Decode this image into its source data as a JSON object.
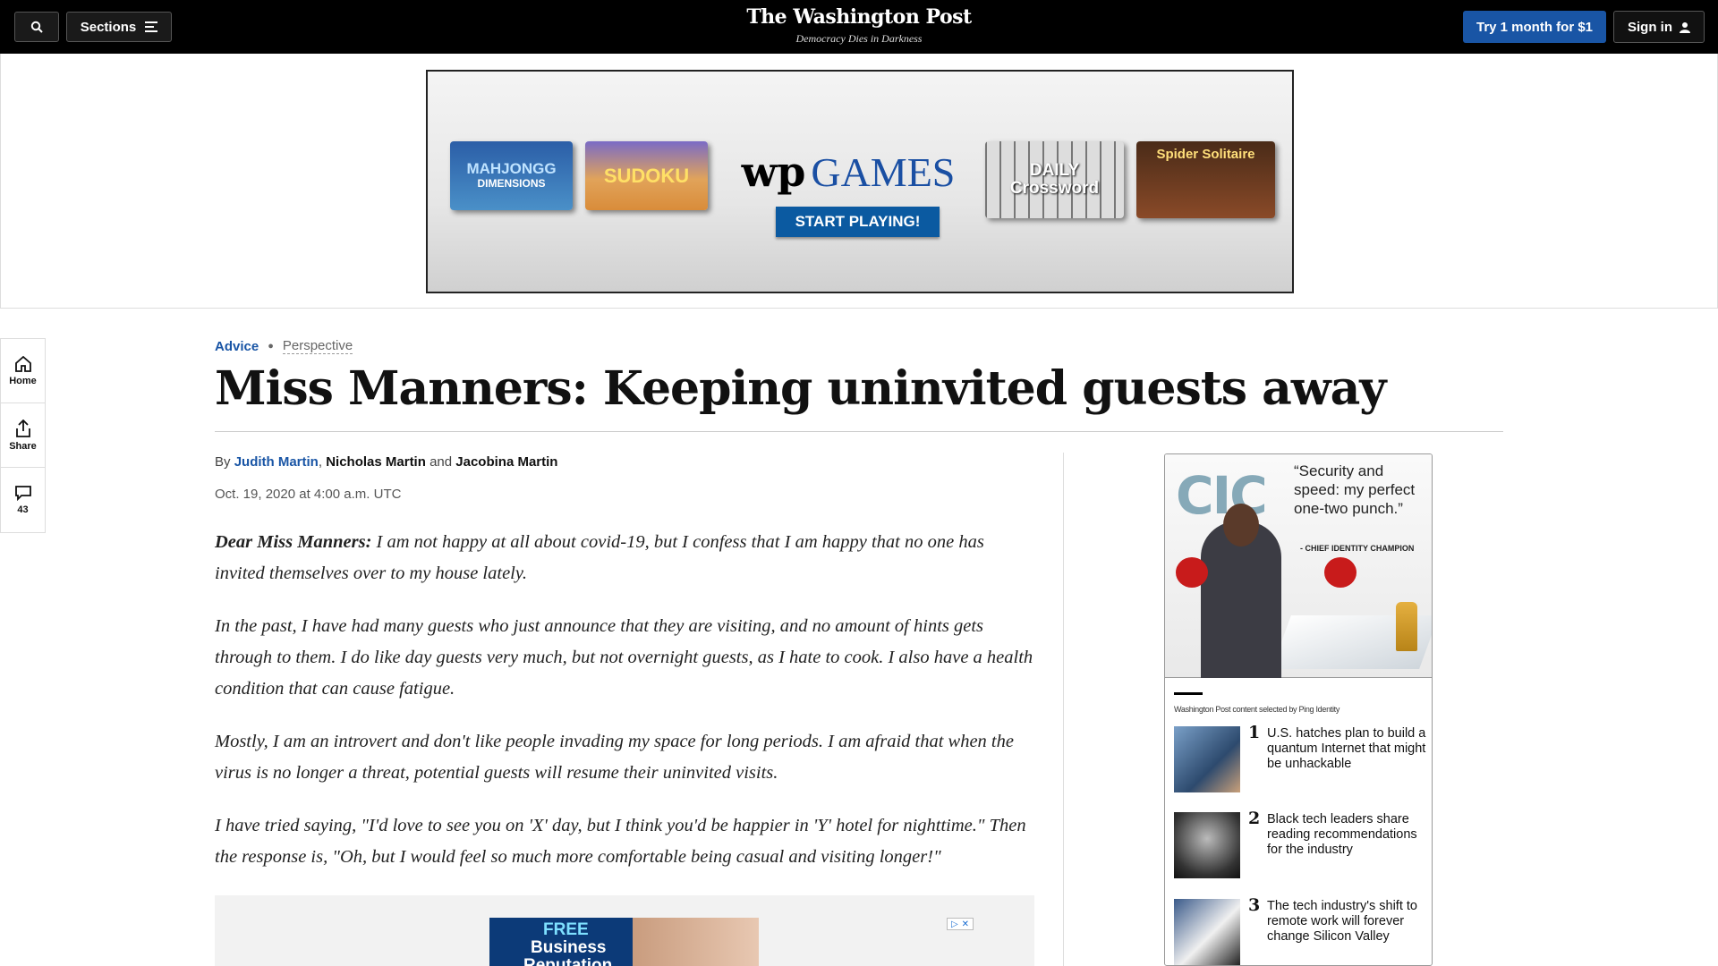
{
  "topbar": {
    "sections_label": "Sections",
    "logo": "The Washington Post",
    "tagline": "Democracy Dies in Darkness",
    "try_label": "Try 1 month for $1",
    "signin_label": "Sign in"
  },
  "ad": {
    "mahjong_title": "MAHJONGG",
    "mahjong_sub": "DIMENSIONS",
    "sudoku": "SUDOKU",
    "wp": "wp",
    "games": "GAMES",
    "start": "START PLAYING!",
    "cross_1": "DAILY",
    "cross_2": "Crossword",
    "spider": "Spider Solitaire"
  },
  "rail": {
    "home": "Home",
    "share": "Share",
    "comments": "43"
  },
  "article": {
    "kicker_section": "Advice",
    "kicker_label": "Perspective",
    "headline": "Miss Manners: Keeping uninvited guests away",
    "by": "By",
    "author1": "Judith Martin",
    "comma": ",",
    "author2": "Nicholas Martin",
    "and": "and",
    "author3": "Jacobina Martin",
    "date": "Oct. 19, 2020 at 4:00 a.m. UTC",
    "p1_lead": "Dear Miss Manners:",
    "p1": " I am not happy at all about covid-19, but I confess that I am happy that no one has invited themselves over to my house lately.",
    "p2": "In the past, I have had many guests who just announce that they are visiting, and no amount of hints gets through to them. I do like day guests very much, but not overnight guests, as I hate to cook. I also have a health condition that can cause fatigue.",
    "p3": "Mostly, I am an introvert and don't like people invading my space for long periods. I am afraid that when the virus is no longer a threat, potential guests will resume their uninvited visits.",
    "p4": "I have tried saying, \"I'd love to see you on 'X' day, but I think you'd be happier in 'Y' hotel for nighttime.\" Then the response is, \"Oh, but I would feel so much more comfortable being casual and visiting longer!\""
  },
  "inline_ad": {
    "line1": "FREE",
    "line2": "Business",
    "line3": "Reputation"
  },
  "sponsor": {
    "logo": "CIC",
    "quote": "“Security and speed: my perfect one-two punch.”",
    "attribution": "- CHIEF IDENTITY CHAMPION",
    "selected_by": "Washington Post content selected by Ping Identity",
    "items": [
      {
        "num": "1",
        "title": "U.S. hatches plan to build a quantum Internet that might be unhackable"
      },
      {
        "num": "2",
        "title": "Black tech leaders share reading recommendations for the industry"
      },
      {
        "num": "3",
        "title": "The tech industry's shift to remote work will forever change Silicon Valley"
      }
    ]
  },
  "colors": {
    "accent": "#1955a5",
    "topbar": "#000000"
  }
}
